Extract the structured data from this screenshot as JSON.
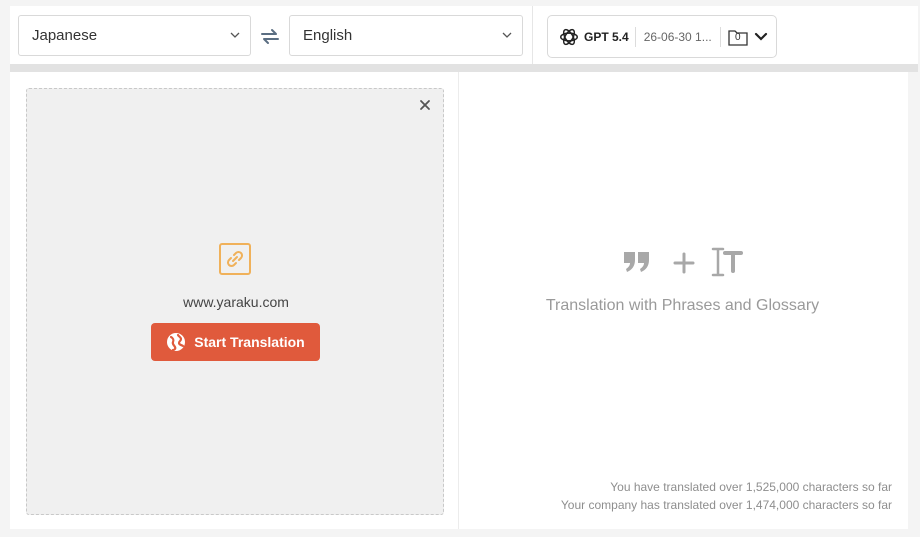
{
  "toolbar": {
    "source_language": "Japanese",
    "target_language": "English",
    "model": {
      "name": "GPT 5.4",
      "date": "26-06-30 1...",
      "folder_count": "0"
    }
  },
  "source_panel": {
    "url": "www.yaraku.com",
    "start_button_label": "Start Translation"
  },
  "target_panel": {
    "caption": "Translation with Phrases and Glossary"
  },
  "stats": {
    "user": "You have translated over 1,525,000 characters so far",
    "company": "Your company has translated over 1,474,000 characters so far"
  },
  "icons": {
    "swap": "swap-arrows-icon",
    "model": "openai-logo-icon",
    "folder": "folder-icon",
    "link": "link-icon",
    "globe": "globe-icon",
    "close": "close-icon",
    "quote": "quote-icon",
    "plus": "plus-icon",
    "glossary": "text-cursor-icon"
  },
  "colors": {
    "accent": "#e05a3c",
    "link_icon": "#f0b15a",
    "muted_text": "#9a9a9a"
  }
}
